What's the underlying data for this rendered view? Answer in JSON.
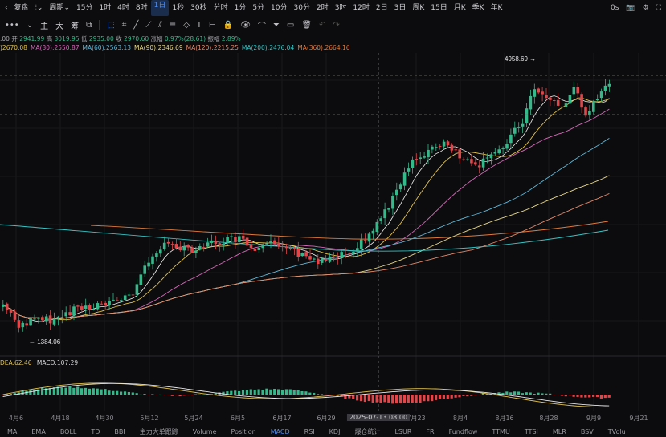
{
  "toolbar": {
    "restore_label": "复盘",
    "period_label": "周期",
    "intervals": [
      "15分",
      "1时",
      "4时",
      "8时",
      "1日",
      "1秒",
      "30秒",
      "分时",
      "1分",
      "5分",
      "10分",
      "30分",
      "2时",
      "3时",
      "12时",
      "2日",
      "3日",
      "周K",
      "15日",
      "月K",
      "季K",
      "年K"
    ],
    "active_interval": "1日",
    "right_label": "0s"
  },
  "toolbar2": {
    "main_label": "主",
    "big_label": "大",
    "chip_label": "筹"
  },
  "ohlc": {
    "prefix": ".00",
    "open_label": "开",
    "open": "2941.99",
    "high_label": "高",
    "high": "3019.95",
    "low_label": "低",
    "low": "2935.00",
    "close_label": "收",
    "close": "2970.60",
    "change_label": "涨幅",
    "change": "0.97%(28.61)",
    "amp_label": "振幅",
    "amp": "2.89%"
  },
  "ma": [
    {
      "text": ")2670.08",
      "color": "#e3c34a"
    },
    {
      "text": "MA(30):2550.87",
      "color": "#d46ab8"
    },
    {
      "text": "MA(60):2563.13",
      "color": "#5fb8d8"
    },
    {
      "text": "MA(90):2346.69",
      "color": "#e8d98a"
    },
    {
      "text": "MA(120):2215.25",
      "color": "#e08a6a"
    },
    {
      "text": "MA(200):2476.04",
      "color": "#35c4c4"
    },
    {
      "text": "MA(360):2664.16",
      "color": "#e07a3a"
    }
  ],
  "annotations": {
    "high_marker": "4958.69",
    "low_marker": "1384.06"
  },
  "macd": {
    "dea": "DEA:62.46",
    "macd": "MACD:107.29"
  },
  "xaxis": {
    "labels": [
      "4月6",
      "4月18",
      "4月30",
      "5月12",
      "5月24",
      "6月5",
      "6月17",
      "6月29",
      "7月23",
      "8月4",
      "8月16",
      "8月28",
      "9月9",
      "9月21"
    ],
    "crosshair_date": "2025-07-13 08:00"
  },
  "tabs": [
    "MA",
    "EMA",
    "BOLL",
    "TD",
    "BBI",
    "主力大单跟踪",
    "Volume",
    "Position",
    "MACD",
    "RSI",
    "KDJ",
    "爆仓统计",
    "LSUR",
    "FR",
    "Fundflow",
    "TTMU",
    "TTSI",
    "MLR",
    "BSV",
    "TVolu"
  ],
  "active_tab": "MACD",
  "colors": {
    "up": "#35b88a",
    "down": "#e0464a",
    "accent": "#4d8ef7"
  },
  "chart_data": {
    "type": "candlestick",
    "series": [
      {
        "name": "MA(30)",
        "values": []
      },
      {
        "name": "MA(60)",
        "values": []
      }
    ]
  }
}
